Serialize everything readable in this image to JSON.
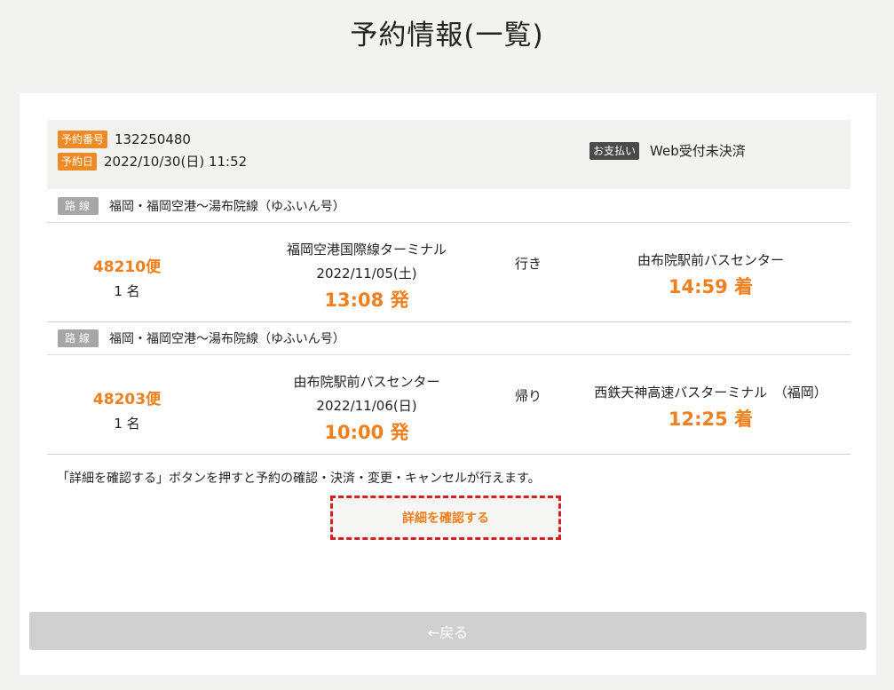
{
  "page_title": "予約情報(一覧)",
  "summary": {
    "reservation_no_label": "予約番号",
    "reservation_no": "132250480",
    "reservation_date_label": "予約日",
    "reservation_date": "2022/10/30(日) 11:52",
    "payment_label": "お支払い",
    "payment_status": "Web受付未決済"
  },
  "trips": [
    {
      "route_label": "路線",
      "route_name": "福岡・福岡空港～湯布院線（ゆふいん号）",
      "flight_no": "48210便",
      "passengers": "1 名",
      "origin": "福岡空港国際線ターミナル",
      "date": "2022/11/05(土)",
      "depart_time": "13:08 発",
      "direction": "行き",
      "destination": "由布院駅前バスセンター",
      "arrive_time": "14:59 着"
    },
    {
      "route_label": "路線",
      "route_name": "福岡・福岡空港～湯布院線（ゆふいん号）",
      "flight_no": "48203便",
      "passengers": "1 名",
      "origin": "由布院駅前バスセンター",
      "date": "2022/11/06(日)",
      "depart_time": "10:00 発",
      "direction": "帰り",
      "destination": "西鉄天神高速バスターミナル　（福岡）",
      "arrive_time": "12:25 着"
    }
  ],
  "note": "「詳細を確認する」ボタンを押すと予約の確認・決済・変更・キャンセルが行えます。",
  "detail_button": "詳細を確認する",
  "back_button": "←戻る",
  "colors": {
    "accent_orange": "#f07f1e",
    "badge_orange": "#f08a24",
    "highlight_red": "#d81f1f",
    "back_button_gray": "#d0d0d0"
  }
}
